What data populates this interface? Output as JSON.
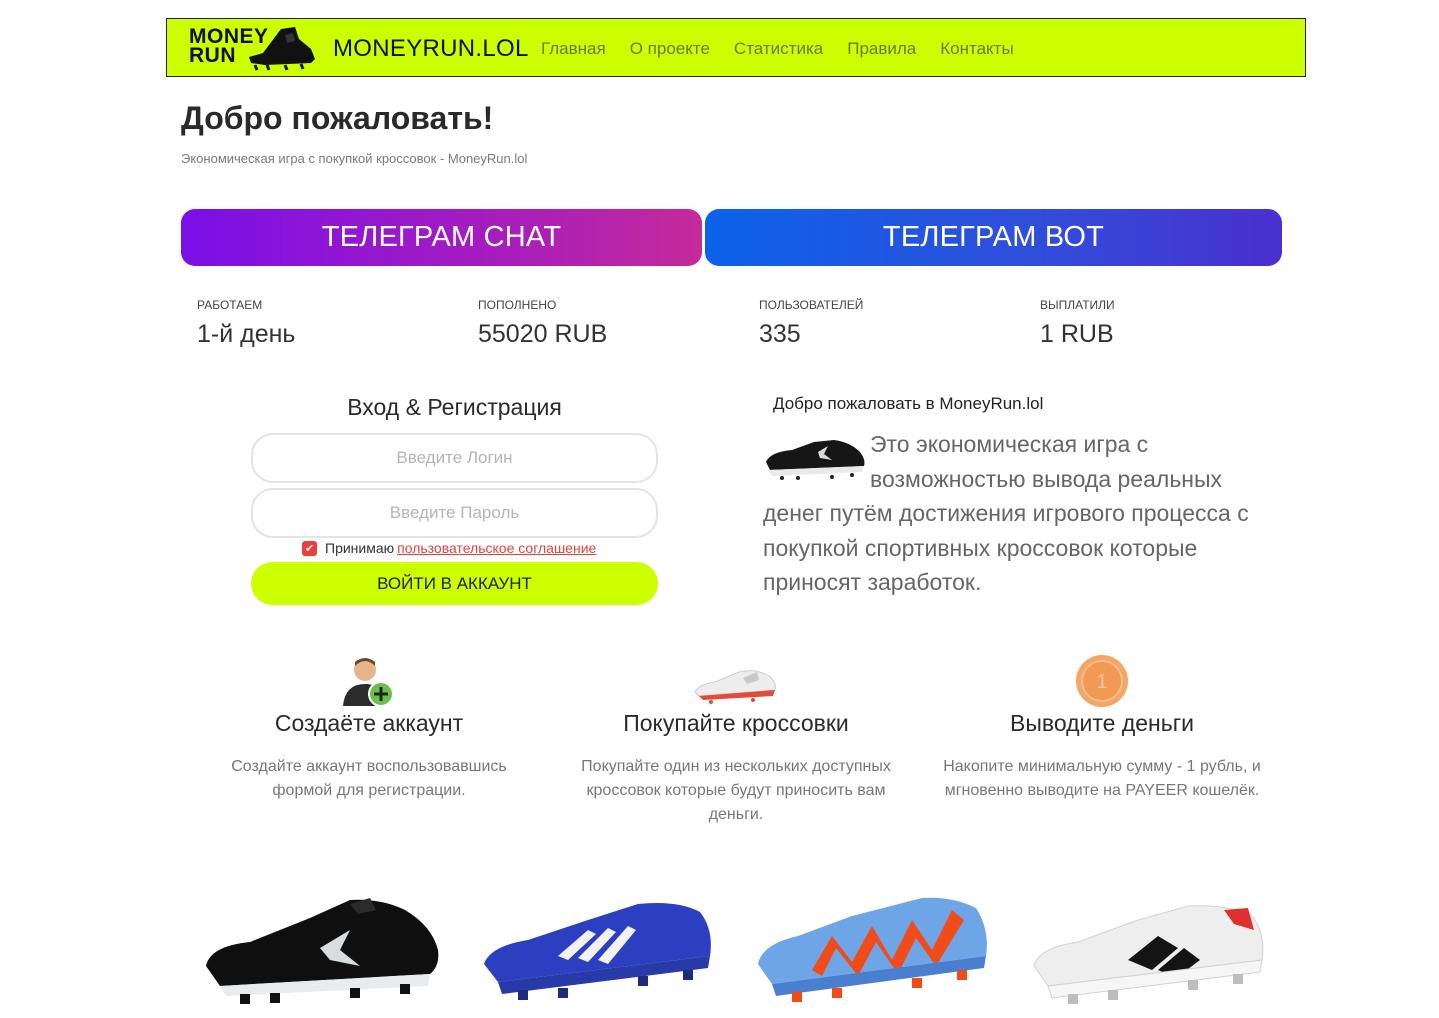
{
  "header": {
    "logo_line1": "MONEY",
    "logo_line2": "RUN",
    "brand": "MONEYRUN.LOL",
    "nav": [
      "Главная",
      "О проекте",
      "Статистика",
      "Правила",
      "Контакты"
    ]
  },
  "hero": {
    "title": "Добро пожаловать!",
    "subtitle": "Экономическая игра с покупкой кроссовок - MoneyRun.lol"
  },
  "telegram": {
    "chat_label": "ТЕЛЕГРАМ CHAT",
    "bot_label": "ТЕЛЕГРАМ ВОТ"
  },
  "stats": [
    {
      "label": "РАБОТАЕМ",
      "value": "1-й день"
    },
    {
      "label": "ПОПОЛНЕНО",
      "value": "55020 RUB"
    },
    {
      "label": "ПОЛЬЗОВАТЕЛЕЙ",
      "value": "335"
    },
    {
      "label": "ВЫПЛАТИЛИ",
      "value": "1 RUB"
    }
  ],
  "login": {
    "title": "Вход & Регистрация",
    "login_placeholder": "Введите Логин",
    "password_placeholder": "Введите Пароль",
    "agree_text": "Принимаю",
    "agree_link": "пользовательское соглашение",
    "submit_label": "ВОЙТИ В АККАУНТ",
    "agreement_checked": true
  },
  "welcome": {
    "heading": "Добро пожаловать в MoneyRun.lol",
    "text": "Это экономическая игра с возможностью вывода реальных денег путём достижения игрового процесса с покупкой спортивных кроссовок которые приносят заработок."
  },
  "features": [
    {
      "icon": "add-user-icon",
      "title": "Создаёте аккаунт",
      "desc": "Создайте аккаунт воспользовавшись формой для регистрации."
    },
    {
      "icon": "sneaker-icon",
      "title": "Покупайте кроссовки",
      "desc": "Покупайте один из нескольких доступных кроссовок которые будут приносить вам деньги."
    },
    {
      "icon": "coin-icon",
      "title": "Выводите деньги",
      "desc": "Накопите минимальную сумму - 1 рубль, и мгновенно выводите на PAYEER кошелёк."
    }
  ],
  "colors": {
    "accent": "#ccff00",
    "chat_gradient": [
      "#7a0fe8",
      "#c52a9a"
    ],
    "bot_gradient": [
      "#0b62ea",
      "#4a2fcf"
    ],
    "link": "#e8413c"
  }
}
